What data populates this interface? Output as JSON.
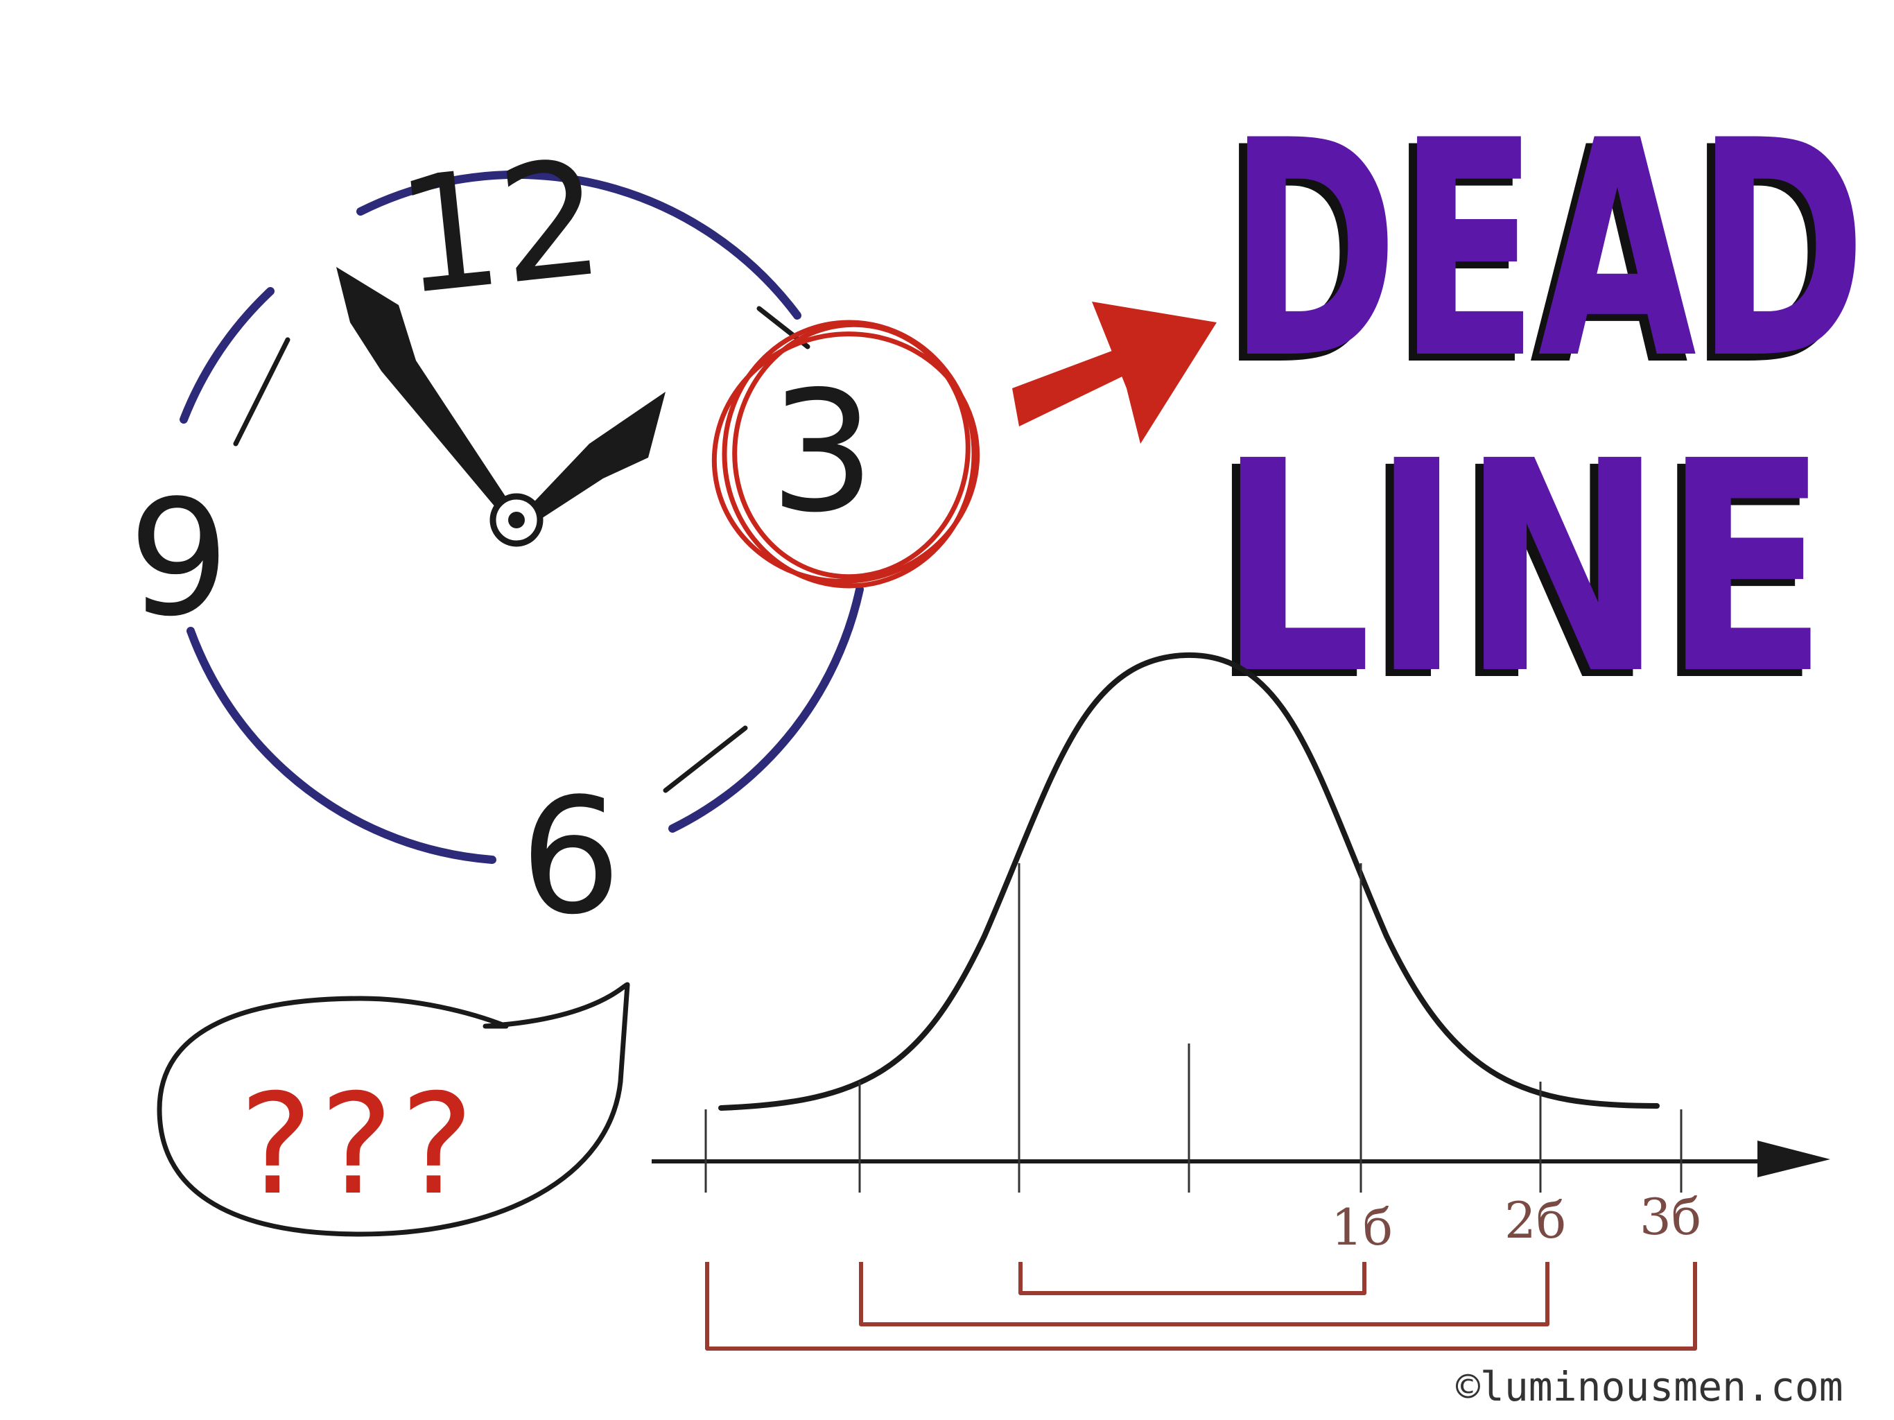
{
  "clock": {
    "numerals": {
      "twelve": "12",
      "three": "3",
      "six": "6",
      "nine": "9"
    },
    "rim_color": "#2d2a7a",
    "highlight_color": "#c8261b"
  },
  "headline": {
    "line1": "DEAD",
    "line2": "LINE",
    "color": "#5b17a8"
  },
  "speech_bubble": {
    "text": "???",
    "color": "#c8261b"
  },
  "distribution": {
    "tick_labels": [
      "1б",
      "2б",
      "3б"
    ],
    "bracket_color": "#9a3a30"
  },
  "copyright": "©luminousmen.com"
}
